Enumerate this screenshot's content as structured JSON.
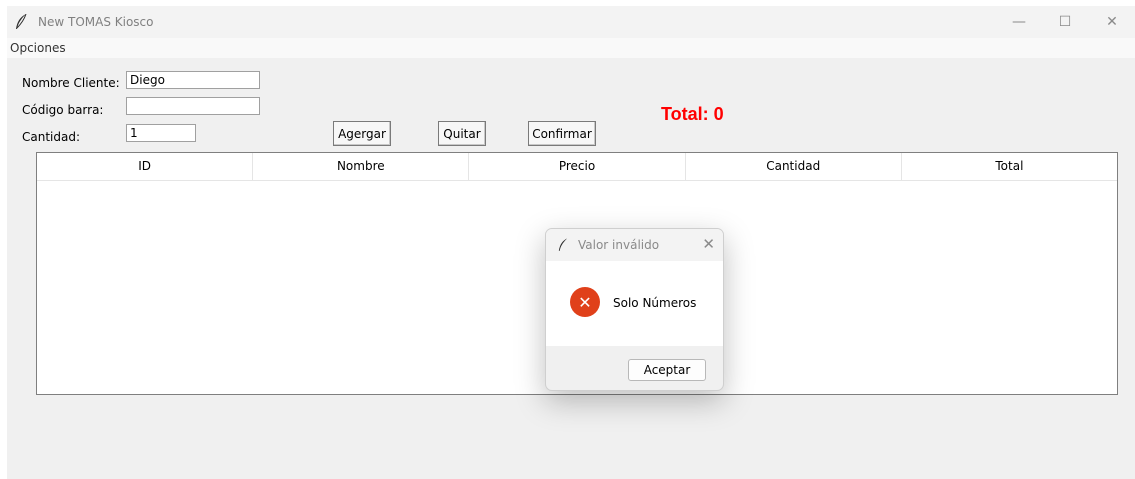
{
  "window": {
    "title": "New TOMAS Kiosco",
    "minimize": "—",
    "maximize": "☐",
    "close": "✕"
  },
  "menu": [
    "Opciones"
  ],
  "form": {
    "cliente_label": "Nombre Cliente:",
    "cliente_value": "Diego",
    "codigo_label": "Código barra:",
    "codigo_value": "",
    "cantidad_label": "Cantidad:",
    "cantidad_value": "1"
  },
  "buttons": {
    "agregar": "Agergar",
    "quitar": "Quitar",
    "confirmar": "Confirmar"
  },
  "total": "Total: 0",
  "table": {
    "columns": [
      "ID",
      "Nombre",
      "Precio",
      "Cantidad",
      "Total"
    ],
    "rows": []
  },
  "dialog": {
    "title": "Valor inválido",
    "close": "✕",
    "icon": "error-icon",
    "message": "Solo Números",
    "ok": "Aceptar"
  },
  "colors": {
    "total": "#ff0000",
    "error_icon": "#e0401a"
  }
}
